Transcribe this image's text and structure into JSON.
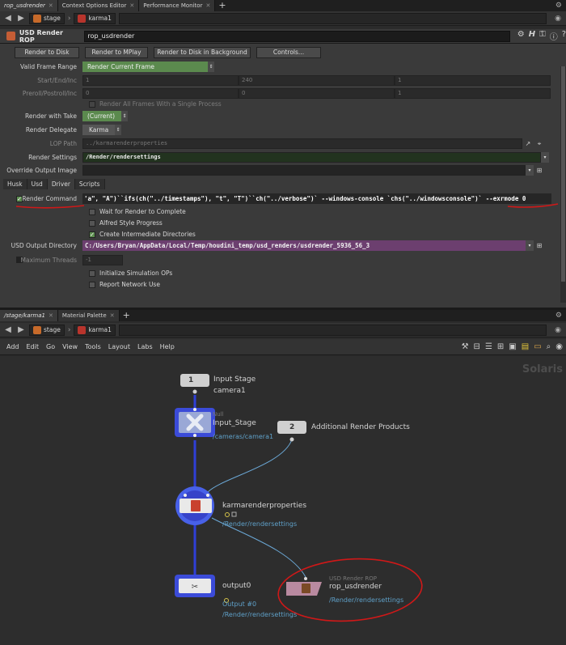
{
  "top_tabs": [
    "rop_usdrender",
    "Context Options Editor",
    "Performance Monitor"
  ],
  "top_path": {
    "stage": "stage",
    "node": "karma1"
  },
  "rop": {
    "type_label": "USD Render ROP",
    "name": "rop_usdrender"
  },
  "buttons": [
    "Render to Disk",
    "Render to MPlay",
    "Render to Disk in Background",
    "Controls..."
  ],
  "params": {
    "valid_frame_range": {
      "label": "Valid Frame Range",
      "value": "Render Current Frame"
    },
    "start_end_inc": {
      "label": "Start/End/Inc",
      "values": [
        "1",
        "240",
        "1"
      ]
    },
    "preroll_postroll": {
      "label": "Preroll/Postroll/Inc",
      "values": [
        "0",
        "0",
        "1"
      ]
    },
    "single_process": {
      "label": "Render All Frames With a Single Process"
    },
    "render_with_take": {
      "label": "Render with Take",
      "value": "(Current)"
    },
    "render_delegate": {
      "label": "Render Delegate",
      "value": "Karma"
    },
    "lop_path": {
      "label": "LOP Path",
      "value": "../karmarenderproperties"
    },
    "render_settings": {
      "label": "Render Settings",
      "value": "/Render/rendersettings"
    },
    "override_output": {
      "label": "Override Output Image",
      "value": ""
    }
  },
  "subtabs": [
    "Husk",
    "Usd",
    "Driver",
    "Scripts"
  ],
  "driver": {
    "render_command_label": "Render Command",
    "render_command_value": "'a\", \"A\")``ifs(ch(\"../timestamps\"), \"t\", \"T\")``ch(\"../verbose\")` --windows-console `chs(\"../windowsconsole\")` --exrmode 0",
    "wait_for_render": "Wait for Render to Complete",
    "alfred_progress": "Alfred Style Progress",
    "create_dirs": "Create Intermediate Directories",
    "usd_output_dir_label": "USD Output Directory",
    "usd_output_dir_value": "C:/Users/Bryan/AppData/Local/Temp/houdini_temp/usd_renders/usdrender_5936_56_3",
    "max_threads_label": "Maximum Threads",
    "max_threads_value": "-1",
    "init_sim_ops": "Initialize Simulation OPs",
    "report_network": "Report Network Use"
  },
  "net_tabs": [
    "/stage/karma1",
    "Material Palette"
  ],
  "net_path": {
    "stage": "stage",
    "node": "karma1"
  },
  "menus": [
    "Add",
    "Edit",
    "Go",
    "View",
    "Tools",
    "Layout",
    "Labs",
    "Help"
  ],
  "watermark": "Solaris",
  "nodes": {
    "input1": {
      "num": "1",
      "label": "Input Stage",
      "sub": "camera1"
    },
    "null": {
      "type": "Null",
      "label": "Input_Stage",
      "sub": "/cameras/camera1"
    },
    "input2": {
      "num": "2",
      "label": "Additional Render Products"
    },
    "krp": {
      "label": "karmarenderproperties",
      "sub": "/Render/rendersettings"
    },
    "output": {
      "label": "output0",
      "sub1": "Output #0",
      "sub2": "/Render/rendersettings"
    },
    "rop": {
      "type": "USD Render ROP",
      "label": "rop_usdrender",
      "sub": "/Render/rendersettings"
    }
  },
  "colors": {
    "accent_green": "#5b8a4e",
    "purple_field": "#6c3f6f",
    "annotation_red": "#d01818",
    "wire_blue": "#2f3fd6",
    "node_blue": "#3b4bd8"
  }
}
